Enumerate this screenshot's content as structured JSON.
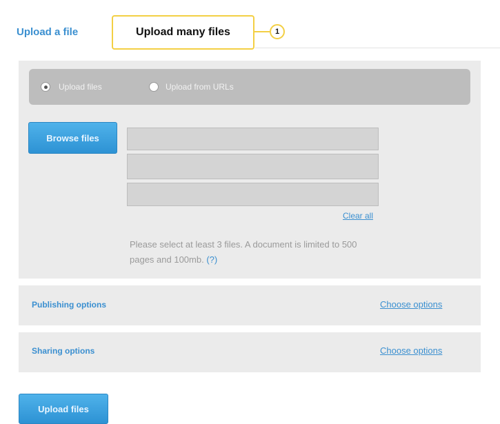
{
  "tabs": {
    "upload_file": "Upload a file",
    "upload_many": "Upload many files"
  },
  "callout": {
    "number": "1"
  },
  "radios": [
    {
      "label": "Upload files",
      "selected": true
    },
    {
      "label": "Upload from URLs",
      "selected": false
    }
  ],
  "browse_button": "Browse files",
  "file_slots_count": 3,
  "clear_all": "Clear all",
  "note": {
    "text": "Please select at least 3 files. A document is limited to 500 pages and 100mb.",
    "help": "(?)"
  },
  "options": [
    {
      "label": "Publishing options",
      "link": "Choose options"
    },
    {
      "label": "Sharing options",
      "link": "Choose options"
    }
  ],
  "upload_button": "Upload files",
  "colors": {
    "accent_blue": "#3a8fd0",
    "callout_yellow": "#f3cf43"
  }
}
